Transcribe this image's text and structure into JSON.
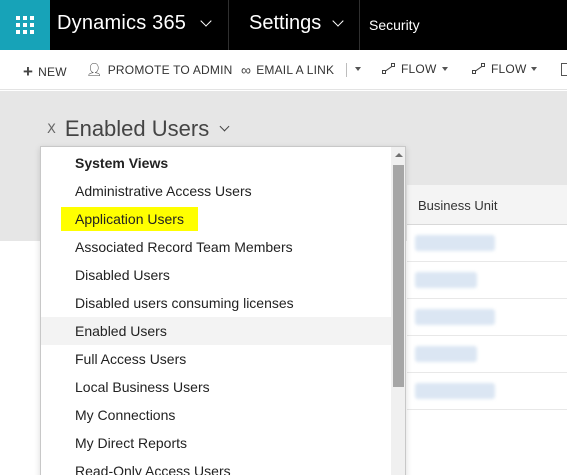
{
  "topbar": {
    "app_name": "Dynamics 365",
    "area_name": "Settings",
    "breadcrumb": "Security",
    "brand_color": "#17a3b8"
  },
  "commands": {
    "new": "NEW",
    "promote": "PROMOTE TO ADMIN",
    "email": "EMAIL A LINK",
    "flow1": "FLOW",
    "flow2": "FLOW"
  },
  "view": {
    "title": "Enabled Users"
  },
  "grid": {
    "column_header": "Business Unit"
  },
  "dropdown": {
    "heading": "System Views",
    "items": [
      "Administrative Access Users",
      "Application Users",
      "Associated Record Team Members",
      "Disabled Users",
      "Disabled users consuming licenses",
      "Enabled Users",
      "Full Access Users",
      "Local Business Users",
      "My Connections",
      "My Direct Reports",
      "Read-Only Access Users"
    ],
    "highlighted_item": "Application Users",
    "hovered_item": "Enabled Users",
    "highlight_color": "#ffff00"
  }
}
